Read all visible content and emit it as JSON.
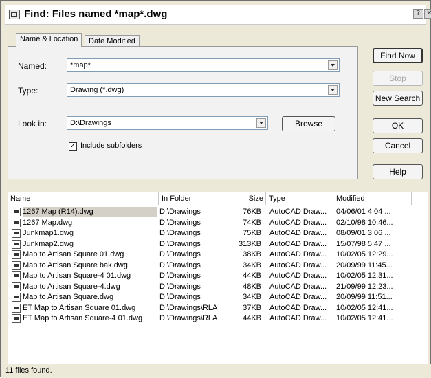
{
  "window": {
    "title": "Find: Files named *map*.dwg"
  },
  "titlebar_buttons": {
    "help": "?",
    "close": "✕"
  },
  "tabs": [
    {
      "label": "Name & Location"
    },
    {
      "label": "Date Modified"
    }
  ],
  "form": {
    "named_label": "Named:",
    "named_value": "*map*",
    "type_label": "Type:",
    "type_value": "Drawing (*.dwg)",
    "lookin_label": "Look in:",
    "lookin_value": "D:\\Drawings",
    "browse_label": "Browse",
    "include_subfolders_label": "Include subfolders",
    "include_subfolders_checked": true
  },
  "buttons": {
    "find_now": "Find Now",
    "stop": "Stop",
    "new_search": "New Search",
    "ok": "OK",
    "cancel": "Cancel",
    "help": "Help"
  },
  "results": {
    "columns": [
      "Name",
      "In Folder",
      "Size",
      "Type",
      "Modified"
    ],
    "rows": [
      {
        "name": "1267 Map (R14).dwg",
        "folder": "D:\\Drawings",
        "size": "76KB",
        "type": "AutoCAD Draw...",
        "modified": "04/06/01 4:04 ..."
      },
      {
        "name": "1267 Map.dwg",
        "folder": "D:\\Drawings",
        "size": "74KB",
        "type": "AutoCAD Draw...",
        "modified": "02/10/98 10:46..."
      },
      {
        "name": "Junkmap1.dwg",
        "folder": "D:\\Drawings",
        "size": "75KB",
        "type": "AutoCAD Draw...",
        "modified": "08/09/01 3:06 ..."
      },
      {
        "name": "Junkmap2.dwg",
        "folder": "D:\\Drawings",
        "size": "313KB",
        "type": "AutoCAD Draw...",
        "modified": "15/07/98 5:47 ..."
      },
      {
        "name": "Map to Artisan Square 01.dwg",
        "folder": "D:\\Drawings",
        "size": "38KB",
        "type": "AutoCAD Draw...",
        "modified": "10/02/05 12:29..."
      },
      {
        "name": "Map to Artisan Square bak.dwg",
        "folder": "D:\\Drawings",
        "size": "34KB",
        "type": "AutoCAD Draw...",
        "modified": "20/09/99 11:45..."
      },
      {
        "name": "Map to Artisan Square-4 01.dwg",
        "folder": "D:\\Drawings",
        "size": "44KB",
        "type": "AutoCAD Draw...",
        "modified": "10/02/05 12:31..."
      },
      {
        "name": "Map to Artisan Square-4.dwg",
        "folder": "D:\\Drawings",
        "size": "48KB",
        "type": "AutoCAD Draw...",
        "modified": "21/09/99 12:23..."
      },
      {
        "name": "Map to Artisan Square.dwg",
        "folder": "D:\\Drawings",
        "size": "34KB",
        "type": "AutoCAD Draw...",
        "modified": "20/09/99 11:51..."
      },
      {
        "name": "ET Map to Artisan Square 01.dwg",
        "folder": "D:\\Drawings\\RLA",
        "size": "37KB",
        "type": "AutoCAD Draw...",
        "modified": "10/02/05 12:41..."
      },
      {
        "name": "ET Map to Artisan Square-4 01.dwg",
        "folder": "D:\\Drawings\\RLA",
        "size": "44KB",
        "type": "AutoCAD Draw...",
        "modified": "10/02/05 12:41..."
      }
    ]
  },
  "status": {
    "text": "11 files found."
  }
}
